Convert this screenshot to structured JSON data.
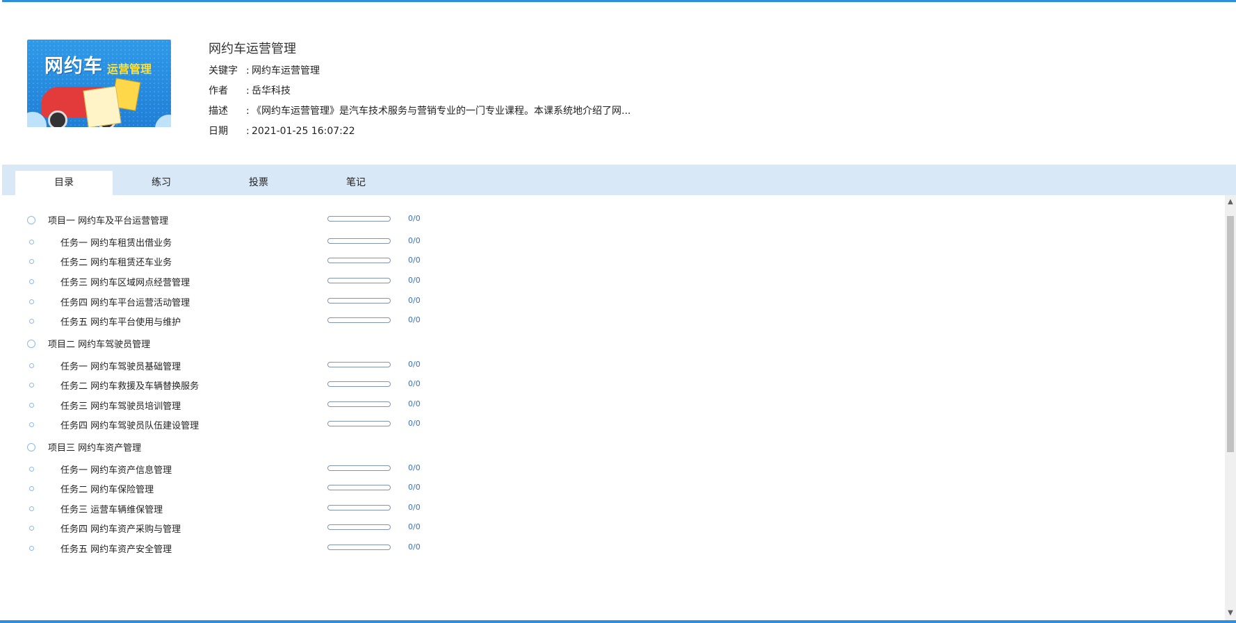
{
  "course": {
    "title": "网约车运营管理",
    "keywords_label": "关键字",
    "keywords": "网约车运营管理",
    "author_label": "作者",
    "author": "岳华科技",
    "description_label": "描述",
    "description": "《网约车运营管理》是汽车技术服务与营销专业的一门专业课程。本课系统地介绍了网...",
    "date_label": "日期",
    "date": "2021-01-25 16:07:22",
    "separator": ":",
    "cover": {
      "title_big": "网约车",
      "title_small": "运营管理",
      "colors": {
        "background": "#2690e3",
        "accent": "#ffe23a"
      }
    }
  },
  "tabs": [
    {
      "label": "目录",
      "active": true
    },
    {
      "label": "练习",
      "active": false
    },
    {
      "label": "投票",
      "active": false
    },
    {
      "label": "笔记",
      "active": false
    }
  ],
  "catalog": [
    {
      "type": "project",
      "label": "项目一 网约车及平台运营管理",
      "progress": 0,
      "count": "0/0"
    },
    {
      "type": "task",
      "label": "任务一 网约车租赁出借业务",
      "progress": 0,
      "count": "0/0"
    },
    {
      "type": "task",
      "label": "任务二 网约车租赁还车业务",
      "progress": 0,
      "count": "0/0"
    },
    {
      "type": "task",
      "label": "任务三 网约车区域网点经营管理",
      "progress": 0,
      "count": "0/0"
    },
    {
      "type": "task",
      "label": "任务四 网约车平台运营活动管理",
      "progress": 0,
      "count": "0/0"
    },
    {
      "type": "task",
      "label": "任务五 网约车平台使用与维护",
      "progress": 0,
      "count": "0/0"
    },
    {
      "type": "project",
      "label": "项目二 网约车驾驶员管理"
    },
    {
      "type": "task",
      "label": "任务一 网约车驾驶员基础管理",
      "progress": 0,
      "count": "0/0"
    },
    {
      "type": "task",
      "label": "任务二 网约车救援及车辆替换服务",
      "progress": 0,
      "count": "0/0"
    },
    {
      "type": "task",
      "label": "任务三 网约车驾驶员培训管理",
      "progress": 0,
      "count": "0/0"
    },
    {
      "type": "task",
      "label": "任务四 网约车驾驶员队伍建设管理",
      "progress": 0,
      "count": "0/0"
    },
    {
      "type": "project",
      "label": "项目三 网约车资产管理"
    },
    {
      "type": "task",
      "label": "任务一 网约车资产信息管理",
      "progress": 0,
      "count": "0/0"
    },
    {
      "type": "task",
      "label": "任务二 网约车保险管理",
      "progress": 0,
      "count": "0/0"
    },
    {
      "type": "task",
      "label": "任务三 运营车辆维保管理",
      "progress": 0,
      "count": "0/0"
    },
    {
      "type": "task",
      "label": "任务四 网约车资产采购与管理",
      "progress": 0,
      "count": "0/0"
    },
    {
      "type": "task",
      "label": "任务五 网约车资产安全管理",
      "progress": 0,
      "count": "0/0"
    }
  ],
  "scrollbar": {
    "up_icon": "chevron-up-icon",
    "down_icon": "chevron-down-icon"
  },
  "colors": {
    "frame": "#2d8ee0",
    "tabbar": "#d9e8f7",
    "count_text": "#3b6fb6"
  }
}
